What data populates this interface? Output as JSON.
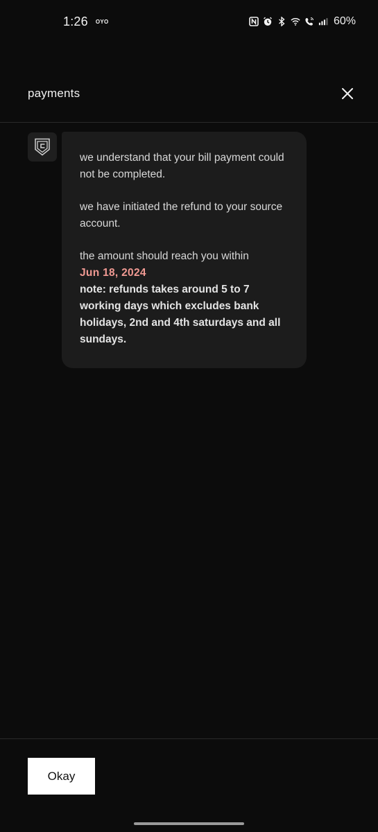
{
  "status_bar": {
    "time": "1:26",
    "carrier_logo": "OYO",
    "battery": "60%",
    "icons": [
      "nfc-icon",
      "alarm-icon",
      "bluetooth-icon",
      "wifi-icon",
      "wifi-calling-icon",
      "signal-icon"
    ]
  },
  "header": {
    "title": "payments"
  },
  "message": {
    "paragraph1": "we understand that your bill payment could not be completed.",
    "paragraph2": "we have initiated the refund to your source account.",
    "paragraph3": "the amount should reach you within",
    "date": "Jun 18, 2024",
    "note": "note: refunds takes around 5 to 7 working days which excludes bank holidays, 2nd and 4th saturdays and all sundays."
  },
  "footer": {
    "okay_label": "Okay"
  },
  "colors": {
    "background": "#0c0c0c",
    "bubble": "#1c1c1c",
    "accent_date": "#f19a93",
    "button": "#ffffff"
  }
}
